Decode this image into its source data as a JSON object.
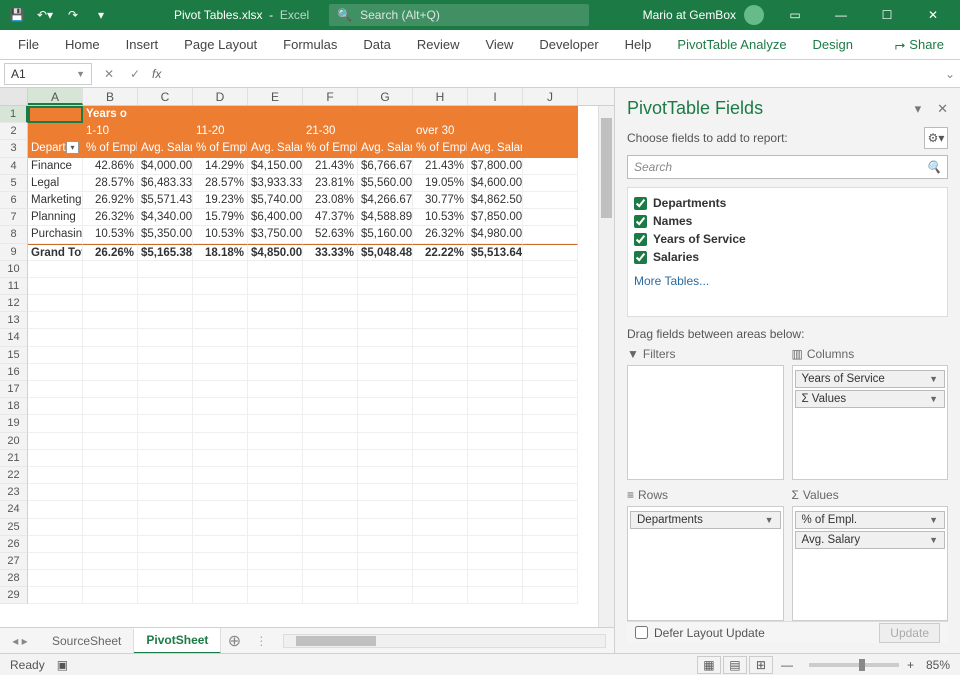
{
  "titlebar": {
    "filename": "Pivot Tables.xlsx",
    "appname": "Excel",
    "search_placeholder": "Search (Alt+Q)",
    "user": "Mario at GemBox"
  },
  "ribbon": {
    "tabs": [
      "File",
      "Home",
      "Insert",
      "Page Layout",
      "Formulas",
      "Data",
      "Review",
      "View",
      "Developer",
      "Help",
      "PivotTable Analyze",
      "Design"
    ],
    "share": "Share"
  },
  "formula_bar": {
    "cell_ref": "A1"
  },
  "grid": {
    "col_headers": [
      "A",
      "B",
      "C",
      "D",
      "E",
      "F",
      "G",
      "H",
      "I",
      "J"
    ],
    "header_row1": {
      "b": "Years o"
    },
    "header_row2": {
      "b": "1-10",
      "d": "11-20",
      "f": "21-30",
      "h": "over 30"
    },
    "header_row3": {
      "a": "Depart",
      "b": "% of Empl",
      "c": "Avg. Salar",
      "d": "% of Empl",
      "e": "Avg. Salar",
      "f": "% of Empl",
      "g": "Avg. Salar",
      "h": "% of Empl",
      "i": "Avg. Salary"
    },
    "data": [
      {
        "a": "Finance",
        "b": "42.86%",
        "c": "$4,000.00",
        "d": "14.29%",
        "e": "$4,150.00",
        "f": "21.43%",
        "g": "$6,766.67",
        "h": "21.43%",
        "i": "$7,800.00"
      },
      {
        "a": "Legal",
        "b": "28.57%",
        "c": "$6,483.33",
        "d": "28.57%",
        "e": "$3,933.33",
        "f": "23.81%",
        "g": "$5,560.00",
        "h": "19.05%",
        "i": "$4,600.00"
      },
      {
        "a": "Marketing",
        "b": "26.92%",
        "c": "$5,571.43",
        "d": "19.23%",
        "e": "$5,740.00",
        "f": "23.08%",
        "g": "$4,266.67",
        "h": "30.77%",
        "i": "$4,862.50"
      },
      {
        "a": "Planning",
        "b": "26.32%",
        "c": "$4,340.00",
        "d": "15.79%",
        "e": "$6,400.00",
        "f": "47.37%",
        "g": "$4,588.89",
        "h": "10.53%",
        "i": "$7,850.00"
      },
      {
        "a": "Purchasin",
        "b": "10.53%",
        "c": "$5,350.00",
        "d": "10.53%",
        "e": "$3,750.00",
        "f": "52.63%",
        "g": "$5,160.00",
        "h": "26.32%",
        "i": "$4,980.00"
      }
    ],
    "grand_total": {
      "a": "Grand Tota",
      "b": "26.26%",
      "c": "$5,165.38",
      "d": "18.18%",
      "e": "$4,850.00",
      "f": "33.33%",
      "g": "$5,048.48",
      "h": "22.22%",
      "i": "$5,513.64"
    }
  },
  "sheets": {
    "tabs": [
      "SourceSheet",
      "PivotSheet"
    ],
    "active_index": 1
  },
  "field_pane": {
    "title": "PivotTable Fields",
    "subtitle": "Choose fields to add to report:",
    "search_placeholder": "Search",
    "fields": [
      {
        "name": "Departments",
        "checked": true
      },
      {
        "name": "Names",
        "checked": true
      },
      {
        "name": "Years of Service",
        "checked": true
      },
      {
        "name": "Salaries",
        "checked": true
      }
    ],
    "more": "More Tables...",
    "drag_hint": "Drag fields between areas below:",
    "areas": {
      "filters": {
        "title": "Filters",
        "items": []
      },
      "columns": {
        "title": "Columns",
        "items": [
          "Years of Service",
          "Σ  Values"
        ]
      },
      "rows": {
        "title": "Rows",
        "items": [
          "Departments"
        ]
      },
      "values": {
        "title": "Values",
        "items": [
          "% of Empl.",
          "Avg. Salary"
        ]
      }
    },
    "defer": "Defer Layout Update",
    "update": "Update"
  },
  "statusbar": {
    "ready": "Ready",
    "zoom": "85%"
  }
}
